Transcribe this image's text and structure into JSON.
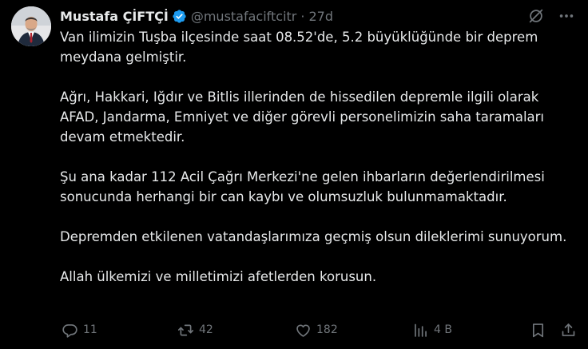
{
  "tweet": {
    "display_name": "Mustafa ÇİFTÇİ",
    "handle": "@mustafaciftcitr",
    "separator": "·",
    "time": "27d",
    "paragraphs": [
      "Van ilimizin Tuşba ilçesinde saat 08.52'de, 5.2 büyüklüğünde bir deprem meydana gelmiştir.",
      "Ağrı, Hakkari, Iğdır ve Bitlis illerinden de hissedilen depremle ilgili olarak AFAD, Jandarma, Emniyet ve diğer görevli personelimizin saha taramaları devam etmektedir.",
      "Şu ana kadar 112 Acil Çağrı Merkezi'ne gelen ihbarların değerlendirilmesi sonucunda herhangi bir can kaybı ve olumsuzluk bulunmamaktadır.",
      "Depremden etkilenen vatandaşlarımıza geçmiş olsun dileklerimi sunuyorum.",
      "Allah ülkemizi ve milletimizi afetlerden korusun."
    ]
  },
  "actions": {
    "replies": "11",
    "reposts": "42",
    "likes": "182",
    "views": "4 B"
  },
  "icons": {
    "verified": "verified-badge-icon",
    "grok": "grok-icon",
    "more": "more-icon",
    "reply": "reply-icon",
    "repost": "repost-icon",
    "like": "like-icon",
    "views": "views-icon",
    "bookmark": "bookmark-icon",
    "share": "share-icon"
  },
  "colors": {
    "background": "#000000",
    "text": "#e7e9ea",
    "muted": "#71767b",
    "verified": "#1d9bf0"
  }
}
